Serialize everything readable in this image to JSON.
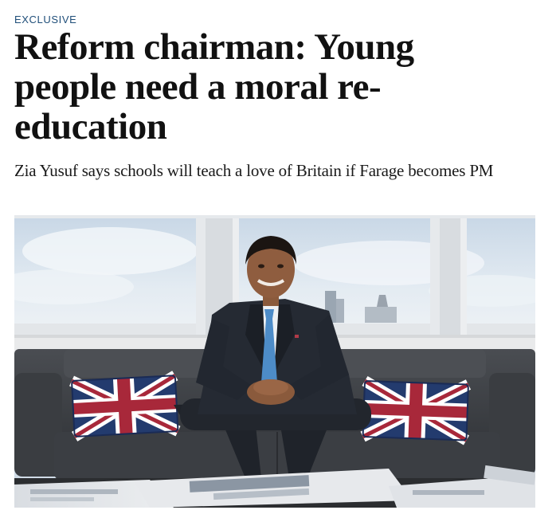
{
  "article": {
    "kicker": "EXCLUSIVE",
    "headline": "Reform chairman: Young people need a moral re-education",
    "standfirst": "Zia Yusuf says schools will teach a love of Britain if Farage becomes PM"
  },
  "photo": {
    "subject": "man in dark suit seated on grey sofa with union jack cushions",
    "colors": {
      "sky": "#dbe5ee",
      "window_frame": "#e6e9ec",
      "sofa": "#3f4246",
      "suit": "#23272f",
      "tie": "#4d8cc8",
      "flag_blue": "#233b6e",
      "flag_red": "#a8283a"
    }
  }
}
